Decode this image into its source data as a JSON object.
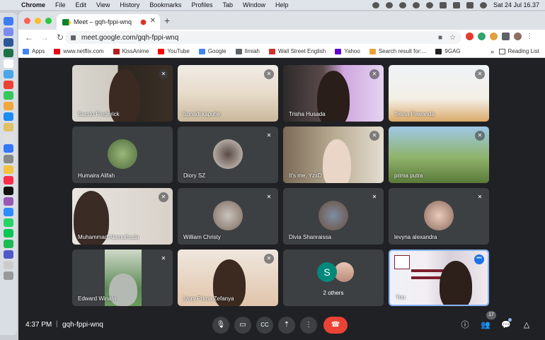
{
  "menubar": {
    "app": "Chrome",
    "items": [
      "File",
      "Edit",
      "View",
      "History",
      "Bookmarks",
      "Profiles",
      "Tab",
      "Window",
      "Help"
    ],
    "datetime": "Sat 24 Jul  16.37"
  },
  "browser": {
    "tab_title": "Meet – gqh-fppi-wnq",
    "url": "meet.google.com/gqh-fppi-wnq",
    "bookmarks": [
      {
        "label": "Apps",
        "color": "#4285f4"
      },
      {
        "label": "www.netflix.com",
        "color": "#e50914"
      },
      {
        "label": "KissAnime",
        "color": "#b71c1c"
      },
      {
        "label": "YouTube",
        "color": "#ff0000"
      },
      {
        "label": "Google",
        "color": "#4285f4"
      },
      {
        "label": "Ilmiah",
        "color": "#5f6368"
      },
      {
        "label": "Wall Street English",
        "color": "#d32f2f"
      },
      {
        "label": "Yahoo",
        "color": "#6001d2"
      },
      {
        "label": "Search result for:...",
        "color": "#e9a23b"
      },
      {
        "label": "9GAG",
        "color": "#222222"
      }
    ],
    "reading_list": "Reading List"
  },
  "participants": [
    {
      "name": "Samto Frederick"
    },
    {
      "name": "bonadi kapuhe"
    },
    {
      "name": "Trisha Husada"
    },
    {
      "name": "Telma Pawanda"
    },
    {
      "name": "Humaira Alifah"
    },
    {
      "name": "Diory SZ"
    },
    {
      "name": "It's me, YzxD"
    },
    {
      "name": "prima putra"
    },
    {
      "name": "Muhammad Alamulhuda"
    },
    {
      "name": "William Christy"
    },
    {
      "name": "Divia Shanraissa"
    },
    {
      "name": "levyna alexandra"
    },
    {
      "name": "Edward Winata"
    },
    {
      "name": "Ivory Prima Zefanya"
    },
    {
      "name": "2 others",
      "initial": "S"
    },
    {
      "name": "You"
    }
  ],
  "meeting": {
    "time": "4:37 PM",
    "code": "gqh-fppi-wnq",
    "participant_count": "17"
  },
  "colors": {
    "accent_blue": "#8ab4f8",
    "end_call_red": "#ea4335",
    "background": "#202124",
    "tile": "#3c4043"
  }
}
